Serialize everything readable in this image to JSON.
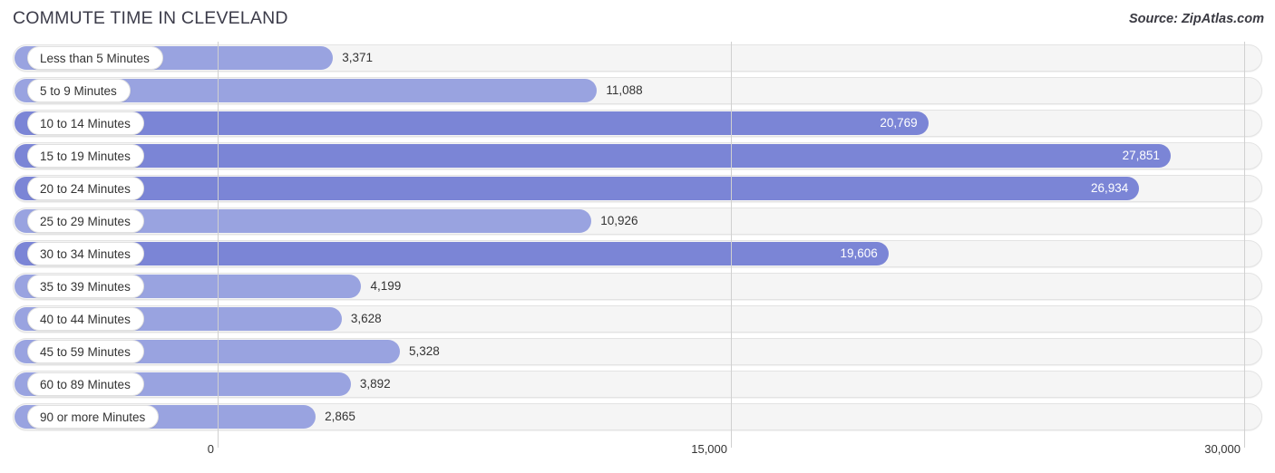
{
  "header": {
    "title": "COMMUTE TIME IN CLEVELAND",
    "source": "Source: ZipAtlas.com"
  },
  "colors": {
    "bar_light": "#99a3e0",
    "bar_dark": "#7b85d6",
    "track": "#f5f5f5",
    "gridline": "#d0d0d0",
    "title_text": "#3c3c4a"
  },
  "chart_data": {
    "type": "bar",
    "orientation": "horizontal",
    "title": "COMMUTE TIME IN CLEVELAND",
    "xlabel": "",
    "ylabel": "",
    "xlim": [
      0,
      30000
    ],
    "grid": true,
    "legend": null,
    "xticks": [
      "0",
      "15,000",
      "30,000"
    ],
    "xtick_values": [
      0,
      15000,
      30000
    ],
    "categories": [
      "Less than 5 Minutes",
      "5 to 9 Minutes",
      "10 to 14 Minutes",
      "15 to 19 Minutes",
      "20 to 24 Minutes",
      "25 to 29 Minutes",
      "30 to 34 Minutes",
      "35 to 39 Minutes",
      "40 to 44 Minutes",
      "45 to 59 Minutes",
      "60 to 89 Minutes",
      "90 or more Minutes"
    ],
    "values": [
      3371,
      11088,
      20769,
      27851,
      26934,
      10926,
      19606,
      4199,
      3628,
      5328,
      3892,
      2865
    ],
    "value_labels": [
      "3,371",
      "11,088",
      "20,769",
      "27,851",
      "26,934",
      "10,926",
      "19,606",
      "4,199",
      "3,628",
      "5,328",
      "3,892",
      "2,865"
    ],
    "label_inside": [
      false,
      false,
      true,
      true,
      true,
      false,
      true,
      false,
      false,
      false,
      false,
      false
    ]
  }
}
